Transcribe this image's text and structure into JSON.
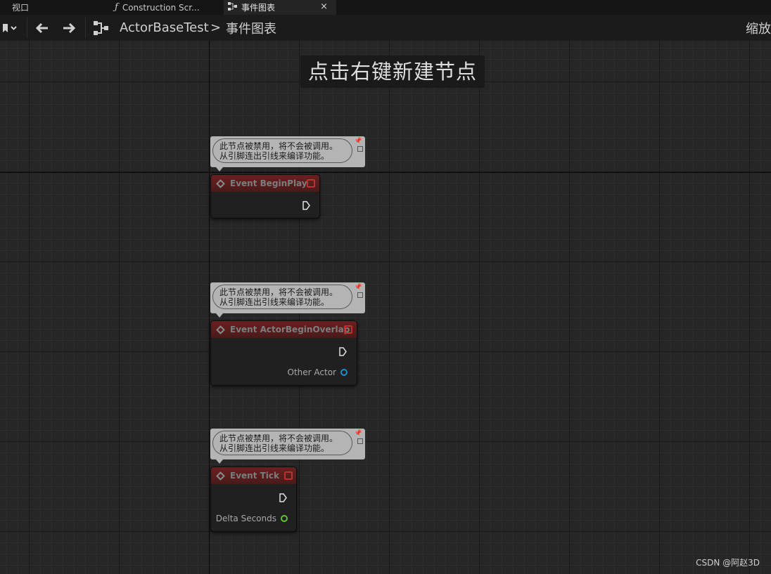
{
  "tabs": [
    {
      "label": "视口",
      "icon": "viewport-grid-icon"
    },
    {
      "label": "Construction Scr...",
      "icon": "function-icon"
    },
    {
      "label": "事件图表",
      "icon": "event-graph-icon",
      "close": "×"
    }
  ],
  "toolbar": {
    "bookmark_icon": "bookmark-icon",
    "back_icon": "back-arrow-icon",
    "forward_icon": "forward-arrow-icon",
    "graph_icon": "event-graph-icon",
    "breadcrumb_root": "ActorBaseTest",
    "breadcrumb_separator": ">",
    "breadcrumb_current": "事件图表",
    "zoom_label": "缩放"
  },
  "graph": {
    "hint": "点击右键新建节点",
    "nodes": [
      {
        "comment": [
          "此节点被禁用，将不会被调用。",
          "从引脚连出引线来编译功能。"
        ],
        "title": "Event BeginPlay",
        "pins": []
      },
      {
        "comment": [
          "此节点被禁用，将不会被调用。",
          "从引脚连出引线来编译功能。"
        ],
        "title": "Event ActorBeginOverlap",
        "pins": [
          {
            "label": "Other Actor",
            "type": "object",
            "color": "#1a8fd0"
          }
        ]
      },
      {
        "comment": [
          "此节点被禁用，将不会被调用。",
          "从引脚连出引线来编译功能。"
        ],
        "title": "Event Tick",
        "pins": [
          {
            "label": "Delta Seconds",
            "type": "float",
            "color": "#5fc33a"
          }
        ]
      }
    ]
  },
  "watermark": "CSDN @阿赵3D"
}
